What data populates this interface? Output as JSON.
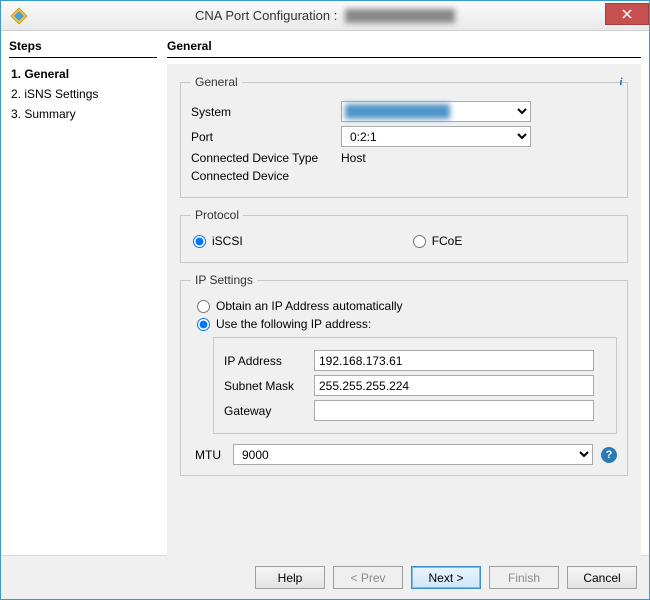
{
  "window": {
    "title_prefix": "CNA Port Configuration :"
  },
  "steps": {
    "heading": "Steps",
    "items": [
      {
        "label": "1. General",
        "active": true
      },
      {
        "label": "2. iSNS Settings",
        "active": false
      },
      {
        "label": "3. Summary",
        "active": false
      }
    ]
  },
  "main": {
    "heading": "General",
    "general": {
      "legend": "General",
      "system_label": "System",
      "system_value": "",
      "port_label": "Port",
      "port_value": "0:2:1",
      "conn_type_label": "Connected Device Type",
      "conn_type_value": "Host",
      "conn_dev_label": "Connected Device",
      "conn_dev_value": ""
    },
    "protocol": {
      "legend": "Protocol",
      "iscsi_label": "iSCSI",
      "fcoe_label": "FCoE",
      "selected": "iscsi"
    },
    "ip": {
      "legend": "IP Settings",
      "auto_label": "Obtain an IP Address automatically",
      "manual_label": "Use the following IP address:",
      "mode": "manual",
      "ip_label": "IP Address",
      "ip_value": "192.168.173.61",
      "mask_label": "Subnet Mask",
      "mask_value": "255.255.255.224",
      "gw_label": "Gateway",
      "gw_value": "",
      "mtu_label": "MTU",
      "mtu_value": "9000"
    }
  },
  "footer": {
    "help": "Help",
    "prev": "< Prev",
    "next": "Next >",
    "finish": "Finish",
    "cancel": "Cancel"
  }
}
